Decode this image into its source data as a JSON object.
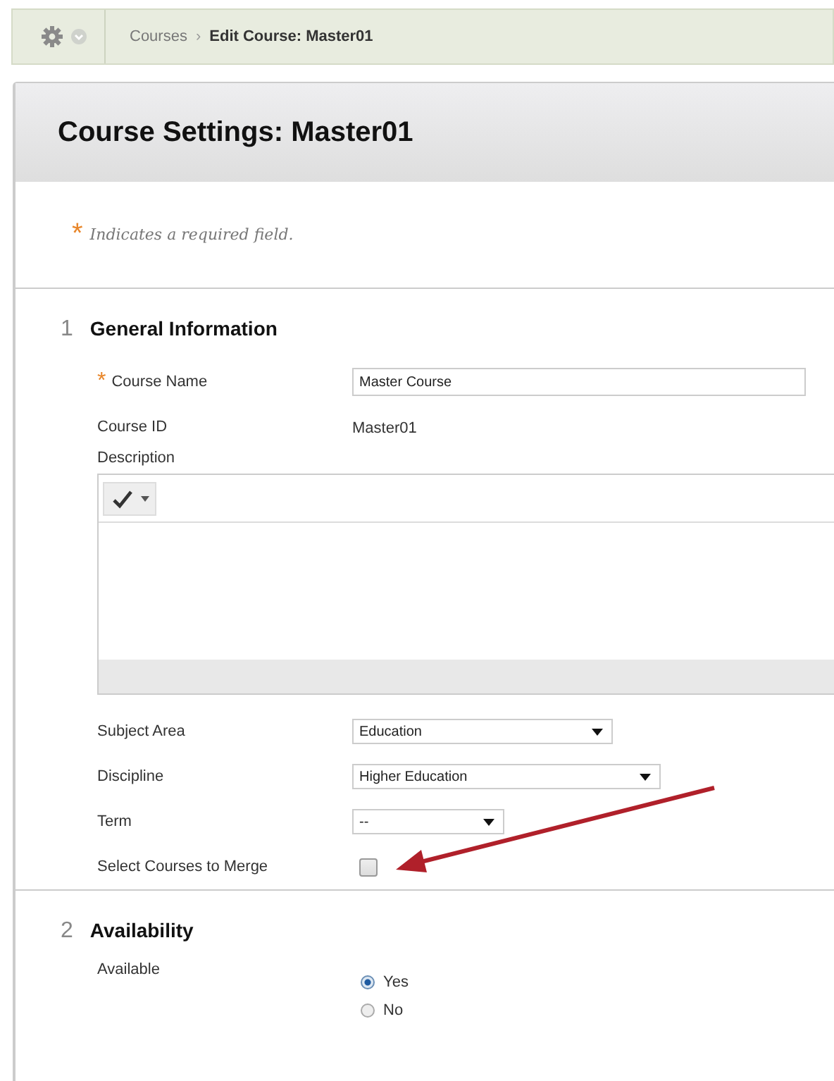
{
  "breadcrumb": {
    "items": [
      {
        "label": "Courses",
        "current": false
      },
      {
        "label": "Edit Course: Master01",
        "current": true
      }
    ],
    "separator": "›"
  },
  "page_title": "Course Settings: Master01",
  "required_note": {
    "marker": "*",
    "text": "Indicates a required field."
  },
  "sections": [
    {
      "number": "1",
      "title": "General Information",
      "fields": [
        {
          "kind": "text_input",
          "label": "Course Name",
          "required": true,
          "value": "Master Course"
        },
        {
          "kind": "text",
          "label": "Course ID",
          "value": "Master01"
        },
        {
          "kind": "editor",
          "label": "Description"
        },
        {
          "kind": "select",
          "label": "Subject Area",
          "value": "Education"
        },
        {
          "kind": "select",
          "label": "Discipline",
          "value": "Higher Education"
        },
        {
          "kind": "select",
          "label": "Term",
          "value": "--"
        },
        {
          "kind": "checkbox",
          "label": "Select Courses to Merge",
          "checked": false,
          "annotated": true
        }
      ]
    },
    {
      "number": "2",
      "title": "Availability",
      "fields": [
        {
          "kind": "radio",
          "label": "Available",
          "options": [
            {
              "label": "Yes",
              "selected": true
            },
            {
              "label": "No",
              "selected": false
            }
          ]
        }
      ]
    }
  ]
}
